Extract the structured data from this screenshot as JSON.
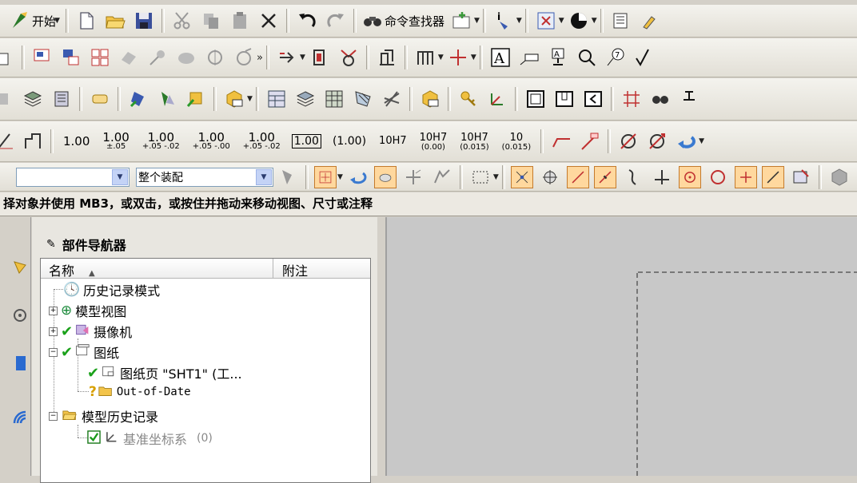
{
  "toolbar1": {
    "start_label": "开始",
    "command_finder_label": "命令查找器"
  },
  "toolbar4": {
    "dims": [
      {
        "main": "1.00",
        "sub": ""
      },
      {
        "main": "1.00",
        "sub": "±.05"
      },
      {
        "main": "1.00",
        "sub": "+.05 -.02"
      },
      {
        "main": "1.00",
        "sub": "+.05 -.00"
      },
      {
        "main": "1.00",
        "sub": "+.05 -.02"
      }
    ],
    "boxed_dim": "1.00",
    "paren_dim": "(1.00)",
    "tol_fit": "10H7",
    "tol_fit2": "10H7",
    "tol_fit3": "10H7",
    "tol_fit4": "10"
  },
  "toolbar5": {
    "filter_value": "",
    "assembly_scope_value": "整个装配"
  },
  "status_bar": {
    "message": "择对象并使用 MB3，或双击，或按住并拖动来移动视图、尺寸或注释"
  },
  "part_navigator": {
    "title": "部件导航器",
    "columns": {
      "name": "名称",
      "note": "附注"
    },
    "items": {
      "history_mode": "历史记录模式",
      "model_views": "模型视图",
      "cameras": "摄像机",
      "drawings": "图纸",
      "sheet": "图纸页 \"SHT1\" (工...",
      "out_of_date": "Out-of-Date",
      "model_history": "模型历史记录",
      "datum_csys": "基准坐标系",
      "datum_csys_suffix": "(0)"
    }
  },
  "colors": {
    "accent_orange": "#ffd89e",
    "check_green": "#1aa11a",
    "canvas_gray": "#c8c8c8"
  }
}
